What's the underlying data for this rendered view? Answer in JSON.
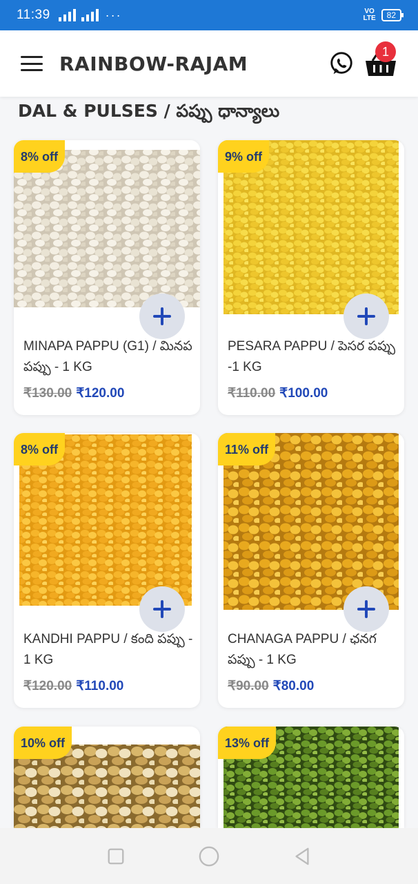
{
  "status_bar": {
    "time": "11:39",
    "network": "4G",
    "volte": "VO LTE",
    "battery": "82"
  },
  "app_bar": {
    "title": "RAINBOW-RAJAM",
    "cart_count": "1"
  },
  "category_title": "DAL & PULSES / పప్పు ధాన్యాలు",
  "products": [
    {
      "discount": "8% off",
      "name": "MINAPA PAPPU (G1) / మినప పప్పు - 1 KG",
      "mrp": "₹130.00",
      "price": "₹120.00",
      "photo": "white-urad-dal"
    },
    {
      "discount": "9% off",
      "name": "PESARA PAPPU / పెసర పప్పు -1 KG",
      "mrp": "₹110.00",
      "price": "₹100.00",
      "photo": "yellow-moong-dal"
    },
    {
      "discount": "8% off",
      "name": "KANDHI PAPPU / కంది పప్పు - 1 KG",
      "mrp": "₹120.00",
      "price": "₹110.00",
      "photo": "orange-toor-dal"
    },
    {
      "discount": "11% off",
      "name": "CHANAGA PAPPU / ఛనగ పప్పు - 1 KG",
      "mrp": "₹90.00",
      "price": "₹80.00",
      "photo": "yellow-chana-dal"
    },
    {
      "discount": "10% off",
      "name": "",
      "mrp": "",
      "price": "",
      "photo": "roasted-chana"
    },
    {
      "discount": "13% off",
      "name": "",
      "mrp": "",
      "price": "",
      "photo": "green-moong"
    }
  ],
  "icons": {
    "menu": "hamburger-menu-icon",
    "whatsapp": "whatsapp-icon",
    "cart": "basket-icon",
    "add": "plus-icon",
    "nav": [
      "square-recents-icon",
      "circle-home-icon",
      "triangle-back-icon"
    ]
  },
  "colors": {
    "status_bar": "#1e78d6",
    "discount_badge": "#ffd21e",
    "price": "#2148b8",
    "cart_badge": "#e8303c"
  }
}
